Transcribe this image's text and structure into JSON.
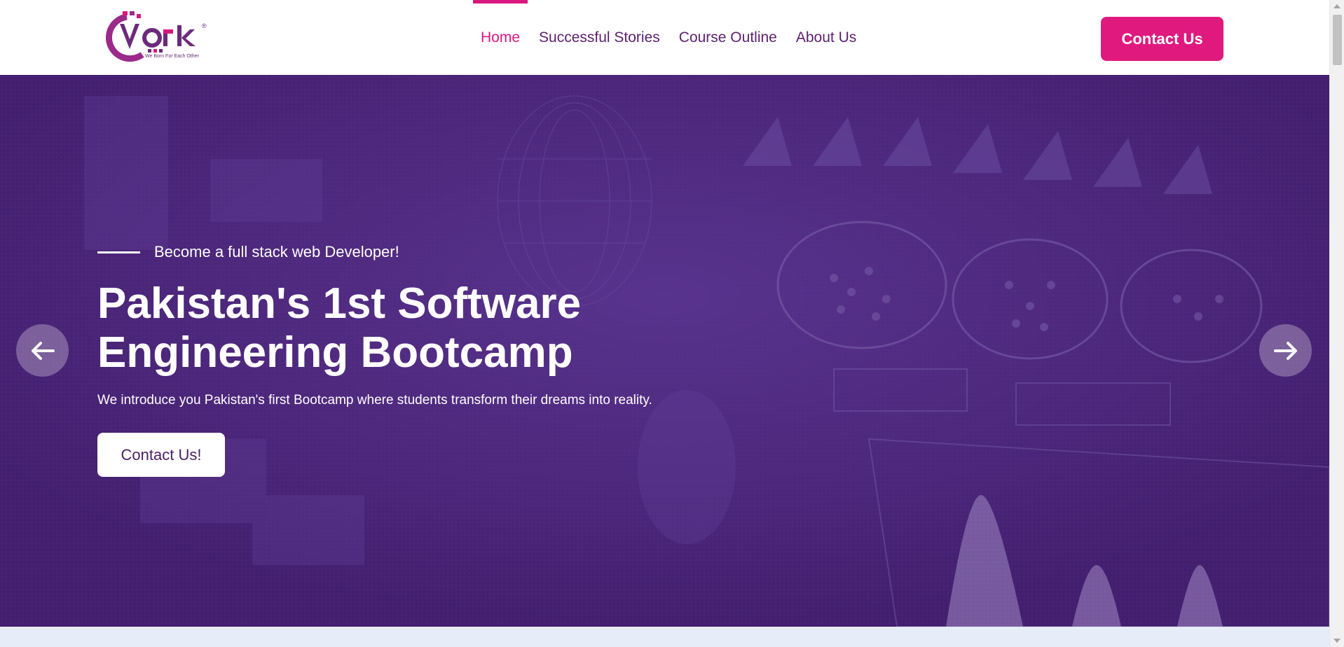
{
  "brand": {
    "logo_text": "Vork",
    "tagline": "We Born For Each Other",
    "registered_mark": "®",
    "colors": {
      "primary": "#5c1f6e",
      "accent": "#e0197f"
    }
  },
  "nav": {
    "items": [
      {
        "label": "Home",
        "active": true
      },
      {
        "label": "Successful Stories",
        "active": false
      },
      {
        "label": "Course Outline",
        "active": false
      },
      {
        "label": "About Us",
        "active": false
      }
    ],
    "contact_label": "Contact Us"
  },
  "hero": {
    "kicker": "Become a full stack web Developer!",
    "title": "Pakistan's 1st Software Engineering Bootcamp",
    "description": "We introduce you Pakistan's first Bootcamp where students transform their dreams into reality.",
    "button_label": "Contact Us!",
    "prev_icon": "arrow-left-icon",
    "next_icon": "arrow-right-icon",
    "overlay_color": "#4a2076"
  }
}
